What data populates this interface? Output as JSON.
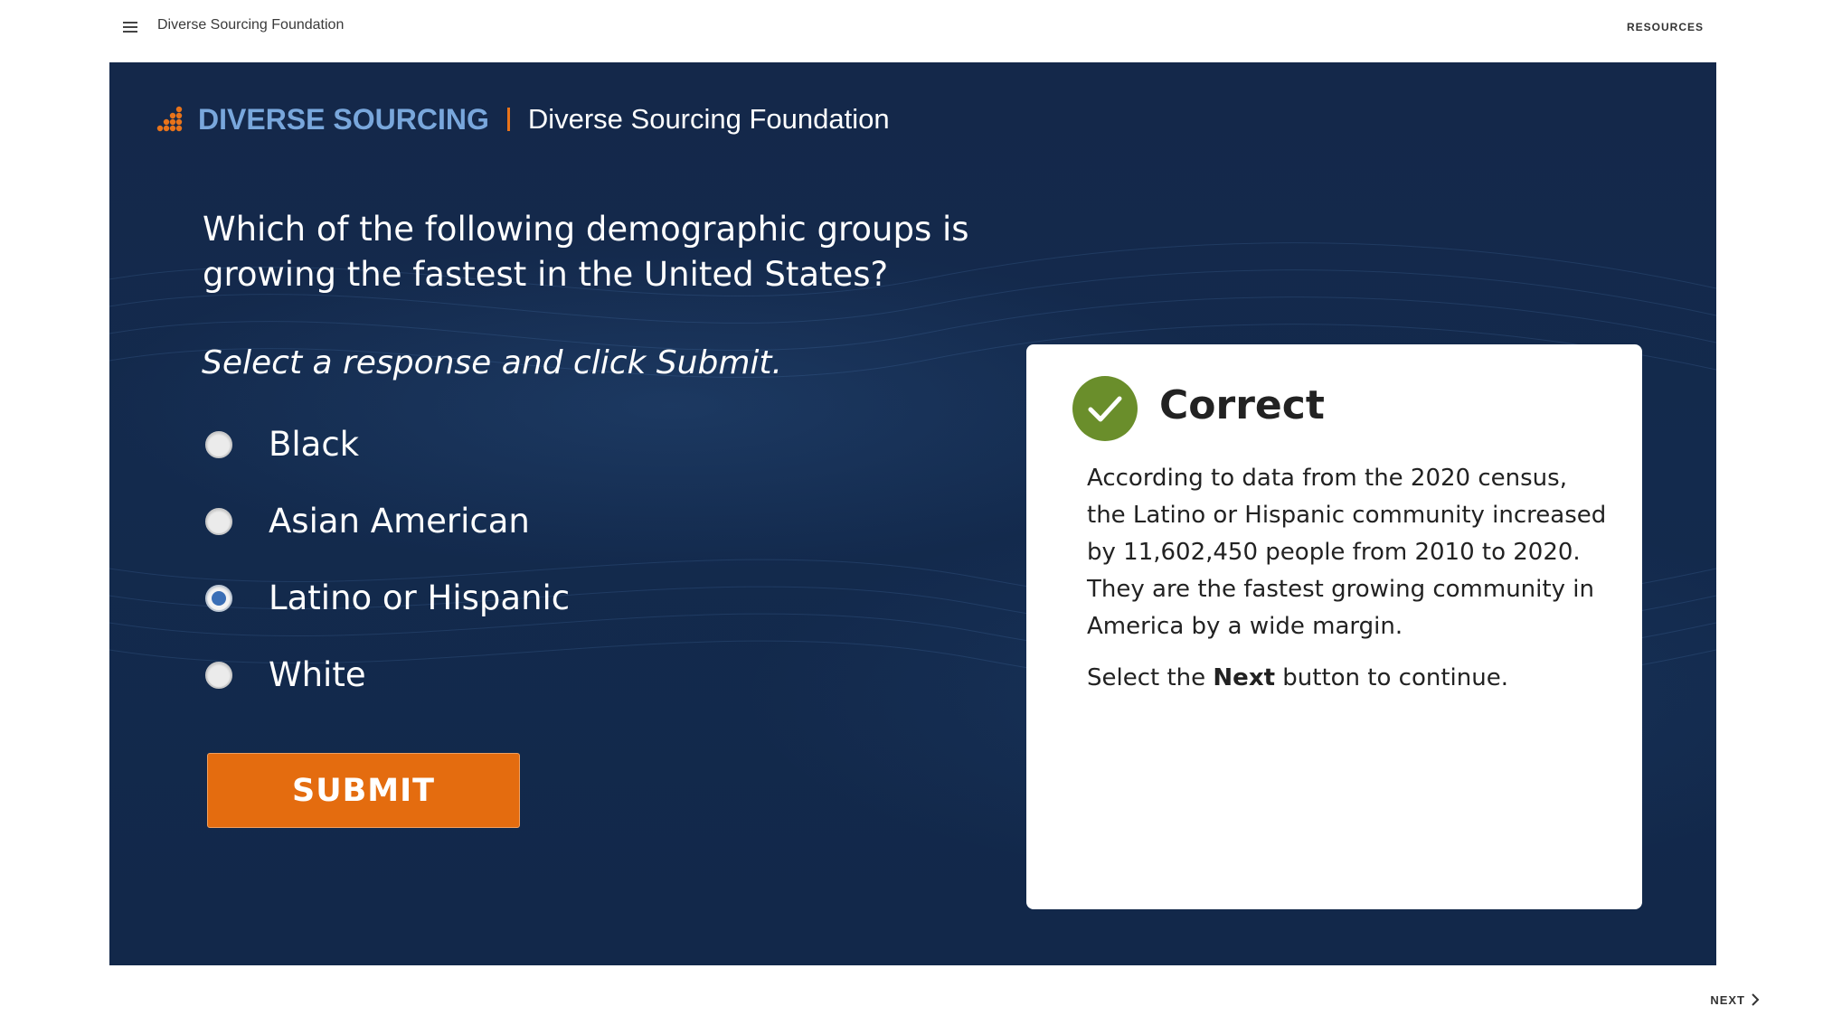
{
  "header": {
    "course_title": "Diverse Sourcing Foundation",
    "resources_label": "RESOURCES",
    "menu_icon": "hamburger-menu-icon"
  },
  "brand": {
    "name": "DIVERSE SOURCING",
    "separator": "|",
    "org": "Diverse Sourcing Foundation",
    "logo_icon": "dots-logo-icon",
    "name_color": "#79a7dc",
    "accent_color": "#e8731a"
  },
  "quiz": {
    "question": "Which of the following demographic groups is growing the fastest in the United States?",
    "instruction": "Select a response and click Submit.",
    "options": [
      {
        "label": "Black",
        "selected": false
      },
      {
        "label": "Asian American",
        "selected": false
      },
      {
        "label": "Latino or Hispanic",
        "selected": true
      },
      {
        "label": "White",
        "selected": false
      }
    ],
    "submit_label": "SUBMIT",
    "submit_color": "#e46c0f"
  },
  "feedback": {
    "title": "Correct",
    "status_icon": "checkmark-circle-icon",
    "status_color": "#6a8e2b",
    "body": "According to data from the 2020 census, the Latino or Hispanic community increased by 11,602,450 people from 2010 to 2020. They are the fastest growing community in America by a wide margin.",
    "next_prefix": "Select the ",
    "next_bold": "Next",
    "next_suffix": " button to continue."
  },
  "nav": {
    "next_label": "NEXT",
    "next_icon": "chevron-right-icon"
  },
  "colors": {
    "stage_background": "#132a4d"
  }
}
